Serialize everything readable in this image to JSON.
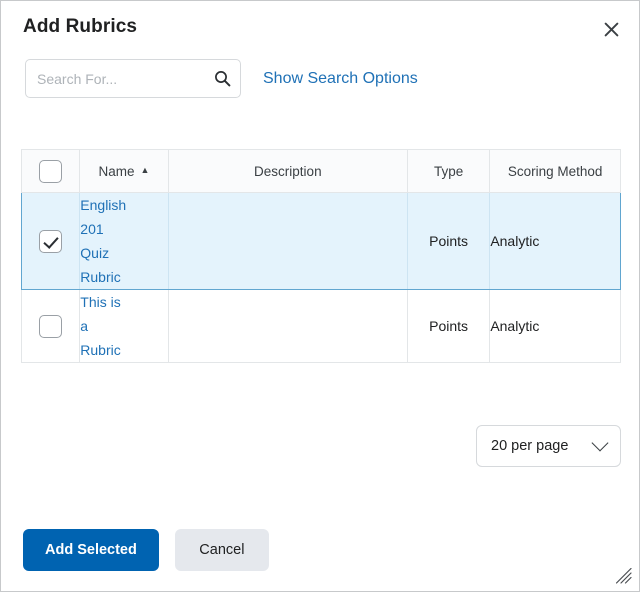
{
  "dialog": {
    "title": "Add Rubrics",
    "close_label": "Close"
  },
  "search": {
    "placeholder": "Search For...",
    "value": "",
    "icon": "search-icon",
    "options_link": "Show Search Options"
  },
  "table": {
    "select_all_checked": false,
    "columns": [
      {
        "key": "check",
        "label": ""
      },
      {
        "key": "name",
        "label": "Name",
        "sort": "ascending",
        "sort_glyph": "▲"
      },
      {
        "key": "description",
        "label": "Description"
      },
      {
        "key": "type",
        "label": "Type"
      },
      {
        "key": "scoring",
        "label": "Scoring Method"
      }
    ],
    "rows": [
      {
        "selected": true,
        "checked": true,
        "name": "English 201 Quiz Rubric",
        "name_lines": [
          "English",
          "201",
          "Quiz",
          "Rubric"
        ],
        "description": "",
        "type": "Points",
        "scoring": "Analytic"
      },
      {
        "selected": false,
        "checked": false,
        "name": "This is a Rubric",
        "name_lines": [
          "This is",
          "a",
          "Rubric"
        ],
        "description": "",
        "type": "Points",
        "scoring": "Analytic"
      }
    ]
  },
  "pagination": {
    "per_page_label": "20 per page",
    "chevron_icon": "chevron-down-icon"
  },
  "footer": {
    "primary_label": "Add Selected",
    "secondary_label": "Cancel"
  },
  "colors": {
    "accent_blue": "#0063b1",
    "link_blue": "#1f71b6",
    "selected_row_bg": "#e4f3fc",
    "selected_row_border": "#61a6d0",
    "secondary_btn_bg": "#e5e8ed"
  }
}
